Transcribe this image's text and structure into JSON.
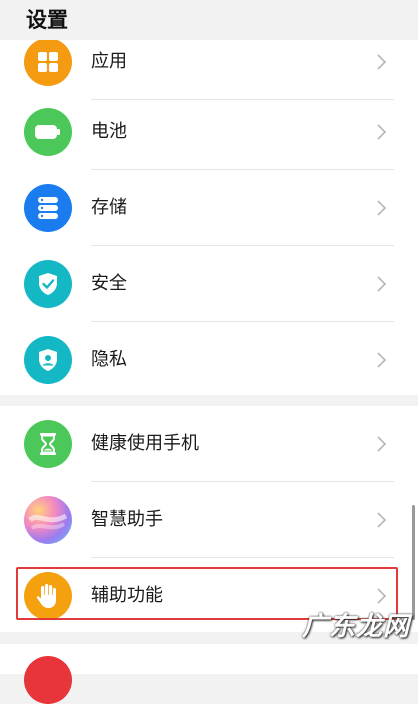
{
  "header": {
    "title": "设置"
  },
  "section1": {
    "items": [
      {
        "label": "应用",
        "icon": "apps-icon",
        "color": "#f59b12"
      },
      {
        "label": "电池",
        "icon": "battery-icon",
        "color": "#4cc75a"
      },
      {
        "label": "存储",
        "icon": "storage-icon",
        "color": "#1b7cf0"
      },
      {
        "label": "安全",
        "icon": "shield-check-icon",
        "color": "#14b8c4"
      },
      {
        "label": "隐私",
        "icon": "privacy-shield-icon",
        "color": "#14b8c4"
      }
    ]
  },
  "section2": {
    "items": [
      {
        "label": "健康使用手机",
        "icon": "hourglass-icon",
        "color": "#4cc75a"
      },
      {
        "label": "智慧助手",
        "icon": "assistant-orb-icon",
        "color": "gradient"
      },
      {
        "label": "辅助功能",
        "icon": "hand-icon",
        "color": "#f5a10f",
        "highlighted": true
      }
    ]
  },
  "highlight_color": "#e03a3a",
  "watermark": "广东龙网"
}
